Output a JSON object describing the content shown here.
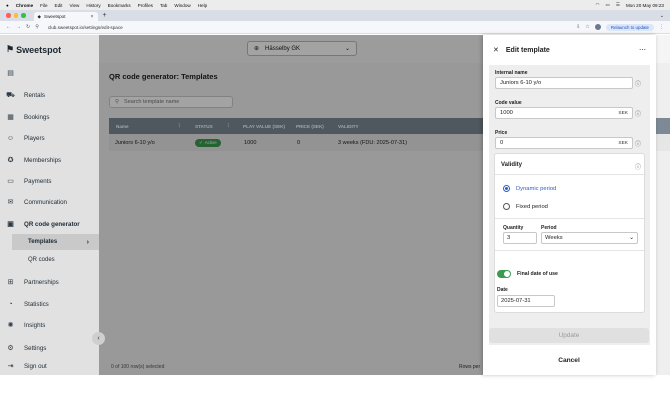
{
  "menubar": {
    "apple": "",
    "items": [
      "Chrome",
      "File",
      "Edit",
      "View",
      "History",
      "Bookmarks",
      "Profiles",
      "Tab",
      "Window",
      "Help"
    ],
    "clock": "Mon 20 May 09:23"
  },
  "browser": {
    "tab_title": "Sweetspot",
    "tab_close": "×",
    "new_tab": "+",
    "url": "club.sweetspot.io/settings/edit-space",
    "relaunch": "Relaunch to update",
    "colors": {
      "red": "#ff5f57",
      "yellow": "#febc2e",
      "green": "#28c840"
    }
  },
  "sidebar": {
    "logo": "Sweetspot",
    "items": [
      {
        "label": "Rentals",
        "icon": "golf-cart-icon"
      },
      {
        "label": "Bookings",
        "icon": "calendar-icon"
      },
      {
        "label": "Players",
        "icon": "players-icon"
      },
      {
        "label": "Memberships",
        "icon": "badge-check-icon"
      },
      {
        "label": "Payments",
        "icon": "payments-icon"
      },
      {
        "label": "Communication",
        "icon": "mail-icon"
      },
      {
        "label": "QR code generator",
        "icon": "qr-grid-icon"
      },
      {
        "label": "Partnerships",
        "icon": "gift-icon"
      },
      {
        "label": "Statistics",
        "icon": "statistics-icon"
      },
      {
        "label": "Insights",
        "icon": "lightbulb-icon"
      },
      {
        "label": "Settings",
        "icon": "settings-icon"
      },
      {
        "label": "Sign out",
        "icon": "sign-out-icon"
      }
    ],
    "subitems": [
      "Templates",
      "QR codes"
    ]
  },
  "main": {
    "venue": "Hässelby GK",
    "page_title": "QR code generator: Templates",
    "search_placeholder": "Search template name",
    "columns": [
      "Name",
      "STATUS",
      "PLAY VALUE (SEK)",
      "PRICE (SEK)",
      "VALIDITY"
    ],
    "rows": [
      {
        "name": "Juniors 6-10 y/o",
        "status": "Active",
        "play_value": "1000",
        "price": "0",
        "validity": "3 weeks (FDU: 2025-07-31)"
      }
    ],
    "footer_left": "0 of 100 row(s) selected",
    "footer_right": "Rows per"
  },
  "panel": {
    "title": "Edit template",
    "internal_name_label": "Internal name",
    "internal_name_value": "Juniors 6-10 y/o",
    "code_value_label": "Code value",
    "code_value_value": "1000",
    "price_label": "Price",
    "price_value": "0",
    "currency": "SEK",
    "validity_title": "Validity",
    "dynamic_period": "Dynamic period",
    "fixed_period": "Fixed period",
    "quantity_label": "Quantity",
    "quantity_value": "3",
    "period_label": "Period",
    "period_value": "Weeks",
    "final_date_label": "Final date of use",
    "date_label": "Date",
    "date_value": "2025-07-31",
    "update_label": "Update",
    "cancel_label": "Cancel"
  }
}
